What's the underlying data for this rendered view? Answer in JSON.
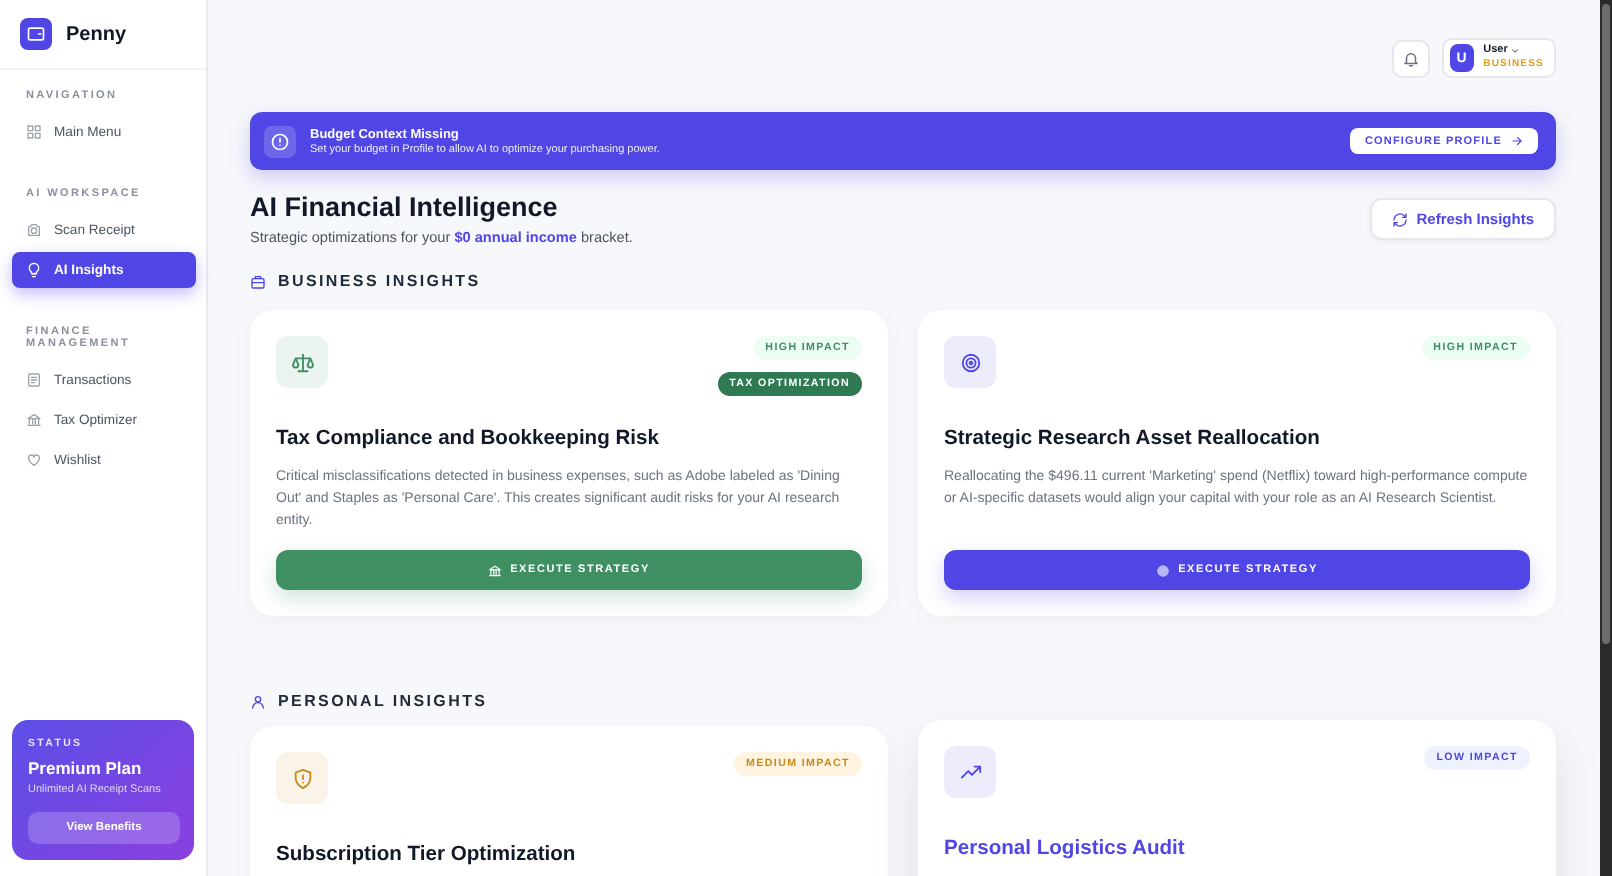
{
  "sidebar": {
    "app_name": "Penny",
    "sections": [
      {
        "label": "NAVIGATION",
        "items": [
          {
            "label": "Main Menu",
            "selected": false
          }
        ]
      },
      {
        "label": "AI WORKSPACE",
        "items": [
          {
            "label": "Scan Receipt",
            "selected": false
          },
          {
            "label": "AI Insights",
            "selected": true
          }
        ]
      },
      {
        "label": "FINANCE MANAGEMENT",
        "items": [
          {
            "label": "Transactions",
            "selected": false
          },
          {
            "label": "Tax Optimizer",
            "selected": false
          },
          {
            "label": "Wishlist",
            "selected": false
          }
        ]
      }
    ],
    "status_card": {
      "label": "STATUS",
      "plan": "Premium Plan",
      "detail": "Unlimited AI Receipt Scans",
      "button": "View Benefits"
    }
  },
  "top_bar": {
    "user": {
      "avatar": "U",
      "name": "User",
      "role": "BUSINESS"
    }
  },
  "alert": {
    "title": "Budget Context Missing",
    "message": "Set your budget in Profile to allow AI to optimize your purchasing power.",
    "button": "CONFIGURE PROFILE"
  },
  "header": {
    "title": "AI Financial Intelligence",
    "subtitle": "Strategic optimizations for your **$0 annual income** bracket.",
    "refresh_button": "Refresh Insights"
  },
  "sections": [
    {
      "title": "BUSINESS INSIGHTS",
      "cards": [
        {
          "color": "#3f8f63",
          "highlighted": false,
          "badges": [
            {
              "kind": "high",
              "text": "HIGH IMPACT"
            },
            {
              "kind": "category",
              "text": "TAX OPTIMIZATION"
            }
          ],
          "title": "Tax Compliance and Bookkeeping Risk",
          "description": "Critical misclassifications detected in business expenses, such as Adobe labeled as 'Dining Out' and Staples as 'Personal Care'. This creates significant audit risks for your AI research entity.",
          "button": "EXECUTE STRATEGY"
        },
        {
          "color": "#4f46e5",
          "highlighted": false,
          "badges": [
            {
              "kind": "high",
              "text": "HIGH IMPACT"
            }
          ],
          "title": "Strategic Research Asset Reallocation",
          "description": "Reallocating the $496.11 current 'Marketing' spend (Netflix) toward high-performance compute or AI-specific datasets would align your capital with your role as an AI Research Scientist.",
          "button": "EXECUTE STRATEGY"
        }
      ]
    },
    {
      "title": "PERSONAL INSIGHTS",
      "cards": [
        {
          "color": "#c98a1b",
          "highlighted": false,
          "badges": [
            {
              "kind": "medium",
              "text": "MEDIUM IMPACT"
            }
          ],
          "title": "Subscription Tier Optimization"
        },
        {
          "color": "#4f46e5",
          "highlighted": true,
          "badges": [
            {
              "kind": "low",
              "text": "LOW IMPACT"
            }
          ],
          "title": "Personal Logistics Audit"
        }
      ]
    }
  ]
}
